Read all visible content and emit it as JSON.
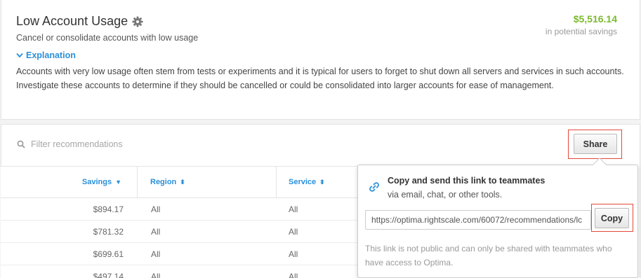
{
  "header": {
    "title": "Low Account Usage",
    "subtitle": "Cancel or consolidate accounts with low usage",
    "savings_amount": "$5,516.14",
    "savings_label": "in potential savings",
    "explanation_toggle": "Explanation",
    "explanation_text": "Accounts with very low usage often stem from tests or experiments and it is typical for users to forget to shut down all servers and services in such accounts. Investigate these accounts to determine if they should be cancelled or could be consolidated into larger accounts for ease of management.",
    "accent_color": "#2a8fd8",
    "savings_color": "#7bbb2c"
  },
  "toolbar": {
    "filter_placeholder": "Filter recommendations",
    "share_label": "Share"
  },
  "table": {
    "columns": [
      "Savings",
      "Region",
      "Service"
    ],
    "rows": [
      {
        "savings": "$894.17",
        "region": "All",
        "service": "All"
      },
      {
        "savings": "$781.32",
        "region": "All",
        "service": "All"
      },
      {
        "savings": "$699.61",
        "region": "All",
        "service": "All"
      },
      {
        "savings": "$497.14",
        "region": "All",
        "service": "All"
      }
    ]
  },
  "share_popover": {
    "title": "Copy and send this link to teammates",
    "subtitle": "via email, chat, or other tools.",
    "link_value": "https://optima.rightscale.com/60072/recommendations/lc",
    "copy_label": "Copy",
    "note": "This link is not public and can only be shared with teammates who have access to Optima."
  },
  "icons": {
    "title_icon": "gear-icon",
    "toggle_icon": "chevron-down-icon",
    "filter_icon": "search-icon",
    "popover_icon": "link-icon",
    "sort_icons": [
      "caret-down-icon",
      "sort-icon",
      "sort-icon"
    ]
  }
}
